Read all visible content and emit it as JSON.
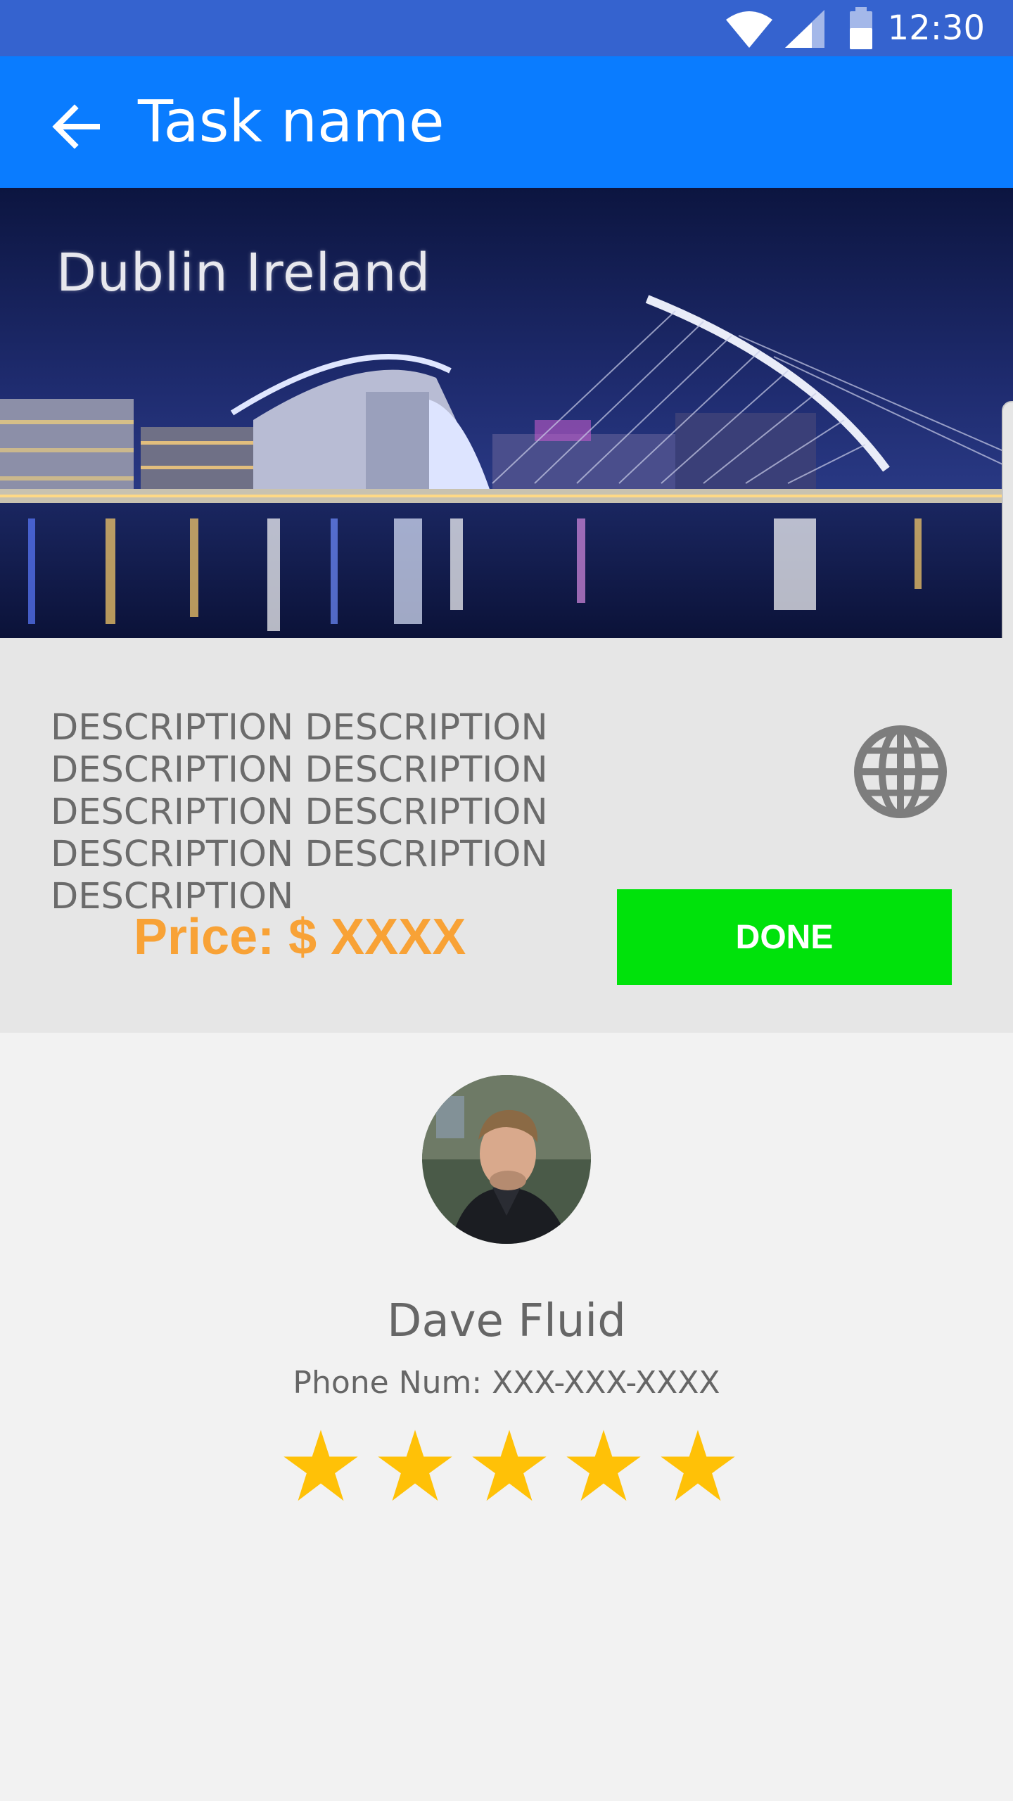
{
  "status_bar": {
    "time": "12:30",
    "icons": [
      "wifi-icon",
      "cell-signal-icon",
      "battery-icon"
    ]
  },
  "app_bar": {
    "back_icon": "arrow-back-icon",
    "title": "Task name"
  },
  "hero": {
    "caption": "Dublin Ireland",
    "image": "night-bridge-skyline-photo"
  },
  "task": {
    "description": "DESCRIPTION DESCRIPTION DESCRIPTION DESCRIPTION DESCRIPTION DESCRIPTION DESCRIPTION DESCRIPTION DESCRIPTION",
    "globe_icon": "globe-icon",
    "price": "Price: $ XXXX",
    "done_label": "DONE"
  },
  "profile": {
    "name": "Dave Fluid",
    "phone": "Phone Num: XXX-XXX-XXXX",
    "rating": 5,
    "rating_max": 5
  },
  "colors": {
    "status_bar": "#3563cf",
    "app_bar": "#0a7cff",
    "price": "#f8a236",
    "done_button": "#00e20b",
    "star": "#ffc107"
  }
}
